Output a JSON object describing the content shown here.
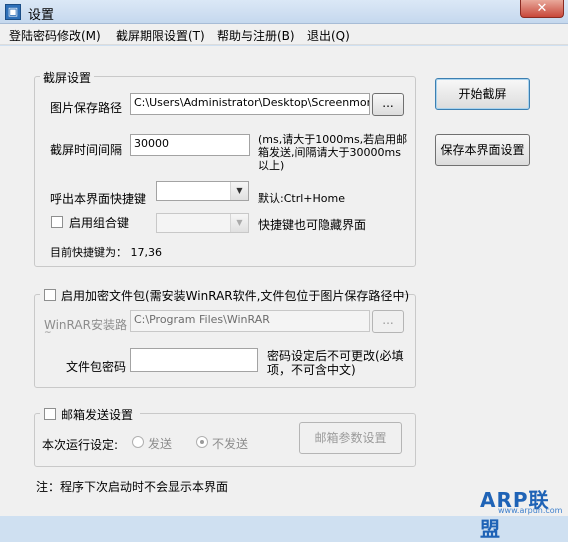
{
  "window": {
    "title": "设置",
    "close_glyph": "✕",
    "icon_glyph": "▣"
  },
  "menu": {
    "items": [
      "登陆密码修改(M)",
      "截屏期限设置(T)",
      "帮助与注册(B)",
      "退出(Q)"
    ]
  },
  "capture_group": {
    "legend": "截屏设置",
    "path_label": "图片保存路径",
    "path_value": "C:\\Users\\Administrator\\Desktop\\Screenmonitor-v",
    "browse_label": "...",
    "interval_label": "截屏时间间隔",
    "interval_value": "30000",
    "interval_hint": "(ms,请大于1000ms,若启用邮箱发送,间隔请大于30000ms以上)",
    "hotkey_label": "呼出本界面快捷键",
    "hotkey_default": "默认:Ctrl+Home",
    "combo_label": "启用组合键",
    "combo_hint": "快捷键也可隐藏界面",
    "current_hotkey": "目前快捷键为：  17,36"
  },
  "encrypt_group": {
    "legend": "启用加密文件包(需安装WinRAR软件,文件包位于图片保存路径中)",
    "winrar_label": "WinRAR安装路",
    "winrar_label_cont": "~",
    "winrar_value": "C:\\Program Files\\WinRAR",
    "browse_label": "...",
    "password_label": "文件包密码",
    "password_value": "",
    "password_hint": "密码设定后不可更改(必填项，不可含中文)"
  },
  "mail_group": {
    "legend": "邮箱发送设置",
    "run_label": "本次运行设定:",
    "send_label": "发送",
    "nosend_label": "不发送",
    "params_button": "邮箱参数设置"
  },
  "buttons": {
    "start": "开始截屏",
    "save": "保存本界面设置"
  },
  "note": "注：程序下次启动时不会显示本界面",
  "watermark": {
    "main": "ARP联盟",
    "sub": "www.arpun.com"
  }
}
